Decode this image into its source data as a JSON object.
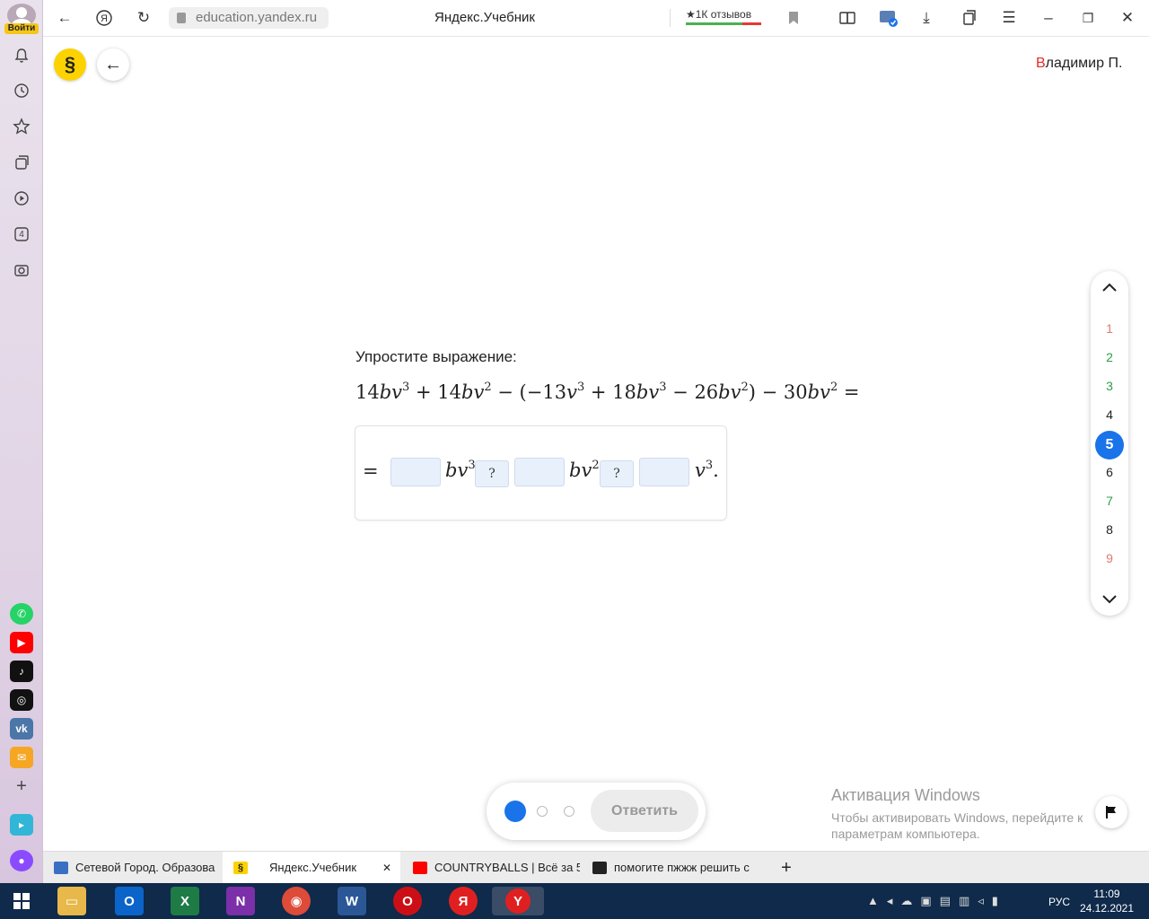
{
  "sidebar": {
    "login_label": "Войти",
    "apps": [
      "whatsapp-icon",
      "youtube-icon",
      "tiktok-icon",
      "camera-app-icon",
      "vk-icon",
      "mail-icon",
      "add-icon",
      "messenger-icon",
      "alice-icon"
    ],
    "widget_number": "4"
  },
  "browser": {
    "url": "education.yandex.ru",
    "title": "Яндекс.Учебник",
    "reviews": "★1К отзывов"
  },
  "header": {
    "logo_symbol": "§",
    "back_symbol": "←",
    "user_first_letter": "В",
    "user_rest": "ладимир П."
  },
  "task": {
    "label": "Упростите выражение:",
    "expression": {
      "p1": "14",
      "v1": "bv",
      "e1": "3",
      "op1": " + ",
      "p2": "14",
      "v2": "bv",
      "e2": "2",
      "op2": " − (−13",
      "v3": "v",
      "e3": "3",
      "op3": " + 18",
      "v4": "bv",
      "e4": "3",
      "op4": " − 26",
      "v5": "bv",
      "e5": "2",
      "op5": ") − 30",
      "v6": "bv",
      "e6": "2",
      "eq": " ="
    },
    "answer": {
      "eq": "=",
      "v1": "bv",
      "e1": "3",
      "select1": "?",
      "v2": "bv",
      "e2": "2",
      "select2": "?",
      "v3": "v",
      "e3": "3",
      "end": "."
    }
  },
  "navigator": {
    "up": "⌃",
    "down": "⌄",
    "items": [
      {
        "n": "1",
        "color": "#e07a6e"
      },
      {
        "n": "2",
        "color": "#2e9e44"
      },
      {
        "n": "3",
        "color": "#2e9e44"
      },
      {
        "n": "4",
        "color": "#222222"
      },
      {
        "n": "5",
        "color": "#ffffff"
      },
      {
        "n": "6",
        "color": "#222222"
      },
      {
        "n": "7",
        "color": "#2e9e44"
      },
      {
        "n": "8",
        "color": "#222222"
      },
      {
        "n": "9",
        "color": "#e07a6e"
      }
    ],
    "current": "5"
  },
  "actions": {
    "submit_label": "Ответить",
    "progress_dots": 3
  },
  "watermark": {
    "line1": "Активация Windows",
    "line2": "Чтобы активировать Windows, перейдите к",
    "line3": "параметрам компьютера."
  },
  "tabs": [
    {
      "label": "Сетевой Город. Образова",
      "active": false
    },
    {
      "label": "Яндекс.Учебник",
      "active": true
    },
    {
      "label": "COUNTRYBALLS | Всё за 5",
      "active": false
    },
    {
      "label": "помогите пжжж решить с",
      "active": false
    }
  ],
  "tab_add": "+",
  "tab_close": "✕",
  "taskbar": {
    "apps": [
      "start",
      "explorer",
      "outlook",
      "excel",
      "onenote",
      "chrome",
      "word",
      "opera",
      "yandex",
      "yandex-browser"
    ],
    "lang": "РУС",
    "time": "11:09",
    "date": "24.12.2021"
  },
  "colors": {
    "accent": "#1a73e8",
    "logo": "#fcd200",
    "correct": "#2e9e44",
    "wrong": "#e07a6e",
    "taskbar": "#0f2a4a"
  }
}
